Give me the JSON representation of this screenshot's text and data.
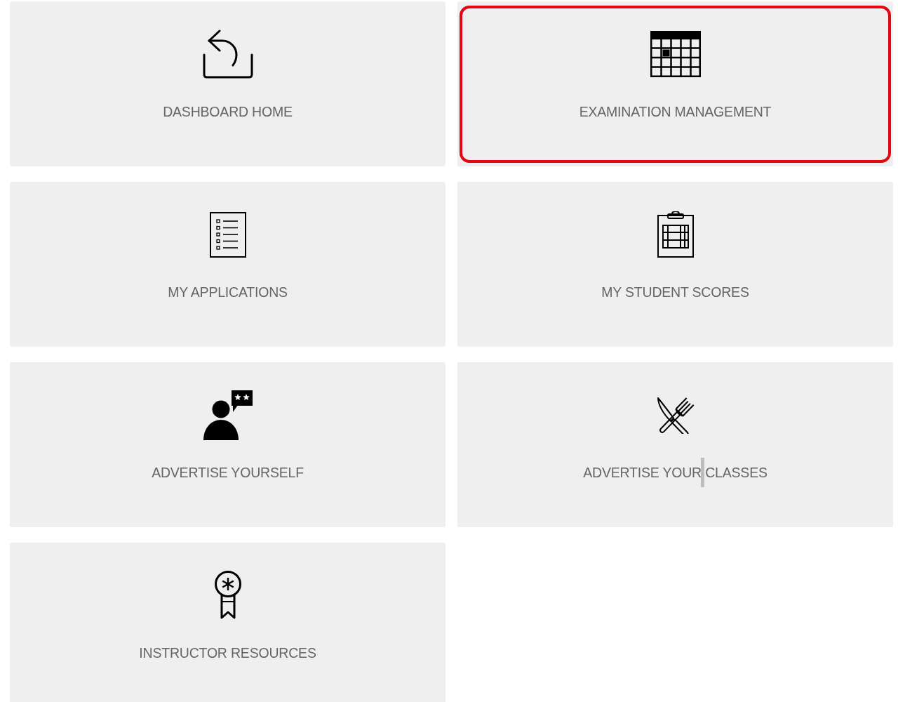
{
  "tiles": [
    {
      "kind": "home",
      "label": "DASHBOARD HOME",
      "selected": false,
      "caret": false
    },
    {
      "kind": "exam",
      "label": "EXAMINATION MANAGEMENT",
      "selected": true,
      "caret": false
    },
    {
      "kind": "applications",
      "label": "MY APPLICATIONS",
      "selected": false,
      "caret": false
    },
    {
      "kind": "scores",
      "label": "MY STUDENT SCORES",
      "selected": false,
      "caret": false
    },
    {
      "kind": "profile",
      "label": "ADVERTISE YOURSELF",
      "selected": false,
      "caret": false
    },
    {
      "kind": "classes",
      "label": "ADVERTISE YOUR CLASSES",
      "selected": false,
      "caret": true
    },
    {
      "kind": "resources",
      "label": "INSTRUCTOR RESOURCES",
      "selected": false,
      "caret": false
    }
  ]
}
